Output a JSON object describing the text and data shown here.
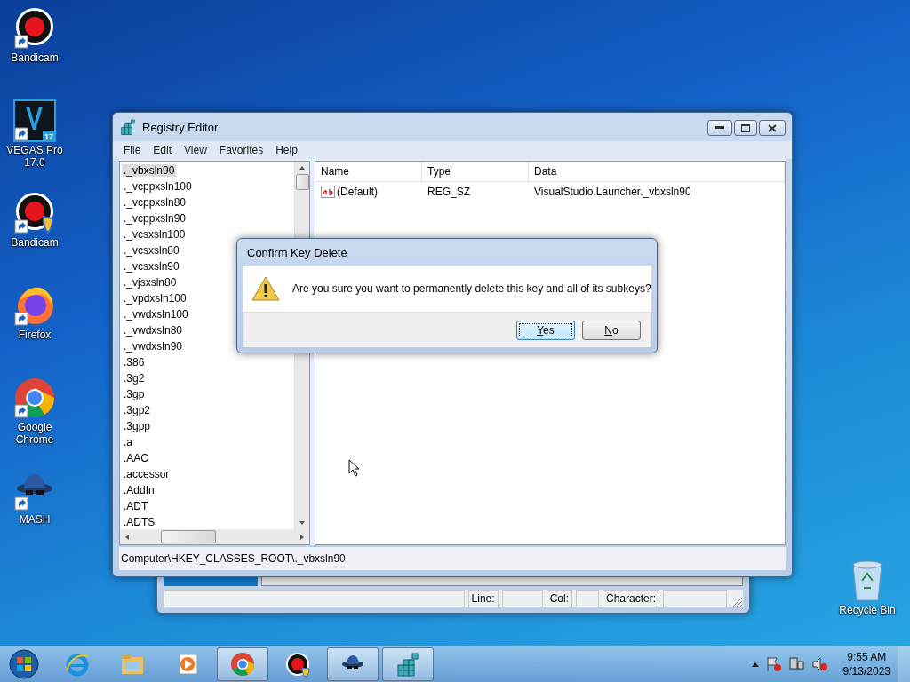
{
  "desktop_icons": [
    {
      "kind": "bandicam",
      "label": "Bandicam"
    },
    {
      "kind": "vegas",
      "label": "VEGAS Pro 17.0",
      "badge": "17"
    },
    {
      "kind": "bandicam_shield",
      "label": "Bandicam"
    },
    {
      "kind": "firefox",
      "label": "Firefox"
    },
    {
      "kind": "chrome",
      "label": "Google Chrome"
    },
    {
      "kind": "mash",
      "label": "MASH"
    }
  ],
  "recycle_bin": {
    "label": "Recycle Bin"
  },
  "background_window": {
    "status_fields": [
      "Line:",
      "Col:",
      "Character:"
    ]
  },
  "registry_editor": {
    "title": "Registry Editor",
    "menu": [
      "File",
      "Edit",
      "View",
      "Favorites",
      "Help"
    ],
    "tree": [
      {
        "label": "._vbxsln90",
        "selected": true
      },
      {
        "label": "._vcppxsln100",
        "selected": false
      },
      {
        "label": "._vcppxsln80",
        "selected": false
      },
      {
        "label": "._vcppxsln90",
        "selected": false
      },
      {
        "label": "._vcsxsln100",
        "selected": false
      },
      {
        "label": "._vcsxsln80",
        "selected": false
      },
      {
        "label": "._vcsxsln90",
        "selected": false
      },
      {
        "label": "._vjsxsln80",
        "selected": false
      },
      {
        "label": "._vpdxsln100",
        "selected": false
      },
      {
        "label": "._vwdxsln100",
        "selected": false
      },
      {
        "label": "._vwdxsln80",
        "selected": false
      },
      {
        "label": "._vwdxsln90",
        "selected": false
      },
      {
        "label": ".386",
        "selected": false
      },
      {
        "label": ".3g2",
        "selected": false
      },
      {
        "label": ".3gp",
        "selected": false
      },
      {
        "label": ".3gp2",
        "selected": false
      },
      {
        "label": ".3gpp",
        "selected": false
      },
      {
        "label": ".a",
        "selected": false
      },
      {
        "label": ".AAC",
        "selected": false
      },
      {
        "label": ".accessor",
        "selected": false
      },
      {
        "label": ".AddIn",
        "selected": false
      },
      {
        "label": ".ADT",
        "selected": false
      },
      {
        "label": ".ADTS",
        "selected": false
      }
    ],
    "columns": [
      "Name",
      "Type",
      "Data"
    ],
    "values": [
      {
        "name": "(Default)",
        "type": "REG_SZ",
        "data": "VisualStudio.Launcher._vbxsln90"
      }
    ],
    "status_bar": "Computer\\HKEY_CLASSES_ROOT\\._vbxsln90"
  },
  "dialog": {
    "title": "Confirm Key Delete",
    "message": "Are you sure you want to permanently delete this key and all of its subkeys?",
    "buttons": [
      {
        "label": "Yes",
        "selected": true
      },
      {
        "label": "No",
        "selected": false
      }
    ]
  },
  "taskbar": {
    "items": [
      {
        "kind": "ie",
        "running": false
      },
      {
        "kind": "explorer",
        "running": false
      },
      {
        "kind": "media",
        "running": false
      },
      {
        "kind": "chrome",
        "running": true
      },
      {
        "kind": "bandicam",
        "running": false
      },
      {
        "kind": "mash",
        "running": true
      },
      {
        "kind": "regedit",
        "running": true
      }
    ],
    "time": "9:55 AM",
    "date": "9/13/2023"
  }
}
